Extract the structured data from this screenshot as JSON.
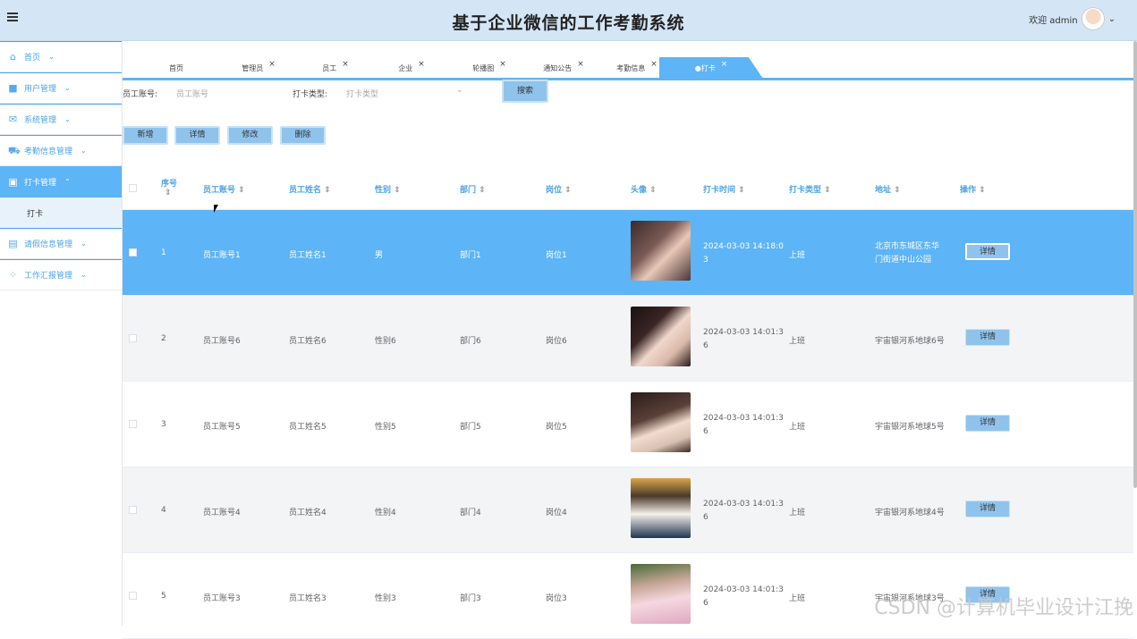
{
  "header": {
    "title": "基于企业微信的工作考勤系统",
    "welcome": "欢迎 admin",
    "avatar_icon": "avatar",
    "chevron": "⌄"
  },
  "sidebar": {
    "items": [
      {
        "label": "首页",
        "icon": "home-icon"
      },
      {
        "label": "用户管理",
        "icon": "user-icon"
      },
      {
        "label": "系统管理",
        "icon": "system-icon"
      },
      {
        "label": "考勤信息管理",
        "icon": "attendance-icon"
      },
      {
        "label": "打卡管理",
        "icon": "clock-icon",
        "sub": "打卡"
      },
      {
        "label": "请假信息管理",
        "icon": "leave-icon"
      },
      {
        "label": "工作汇报管理",
        "icon": "report-icon"
      }
    ]
  },
  "tabs": [
    "首页",
    "管理员",
    "员工",
    "企业",
    "轮播图",
    "通知公告",
    "考勤信息",
    "●打卡"
  ],
  "search": {
    "emp_label": "员工账号:",
    "emp_placeholder": "员工账号",
    "type_label": "打卡类型:",
    "type_placeholder": "打卡类型",
    "search_btn": "搜索"
  },
  "actions": {
    "add": "新增",
    "detail": "详情",
    "edit": "修改",
    "delete": "删除"
  },
  "columns": [
    "序号",
    "员工账号",
    "员工姓名",
    "性别",
    "部门",
    "岗位",
    "头像",
    "打卡时间",
    "打卡类型",
    "地址",
    "操作"
  ],
  "rows": [
    {
      "idx": "1",
      "account": "员工账号1",
      "name": "员工姓名1",
      "gender": "男",
      "dept": "部门1",
      "post": "岗位1",
      "time": "2024-03-03 14:18:0",
      "time2": "3",
      "type": "上班",
      "addr": "北京市东城区东华",
      "addr2": "门街道中山公园",
      "op": "详情"
    },
    {
      "idx": "2",
      "account": "员工账号6",
      "name": "员工姓名6",
      "gender": "性别6",
      "dept": "部门6",
      "post": "岗位6",
      "time": "2024-03-03 14:01:3",
      "time2": "6",
      "type": "上班",
      "addr": "宇宙银河系地球6号",
      "addr2": "",
      "op": "详情"
    },
    {
      "idx": "3",
      "account": "员工账号5",
      "name": "员工姓名5",
      "gender": "性别5",
      "dept": "部门5",
      "post": "岗位5",
      "time": "2024-03-03 14:01:3",
      "time2": "6",
      "type": "上班",
      "addr": "宇宙银河系地球5号",
      "addr2": "",
      "op": "详情"
    },
    {
      "idx": "4",
      "account": "员工账号4",
      "name": "员工姓名4",
      "gender": "性别4",
      "dept": "部门4",
      "post": "岗位4",
      "time": "2024-03-03 14:01:3",
      "time2": "6",
      "type": "上班",
      "addr": "宇宙银河系地球4号",
      "addr2": "",
      "op": "详情"
    },
    {
      "idx": "5",
      "account": "员工账号3",
      "name": "员工姓名3",
      "gender": "性别3",
      "dept": "部门3",
      "post": "岗位3",
      "time": "2024-03-03 14:01:3",
      "time2": "6",
      "type": "上班",
      "addr": "宇宙银河系地球3号",
      "addr2": "",
      "op": "详情"
    }
  ],
  "watermark": "CSDN @计算机毕业设计江挽"
}
